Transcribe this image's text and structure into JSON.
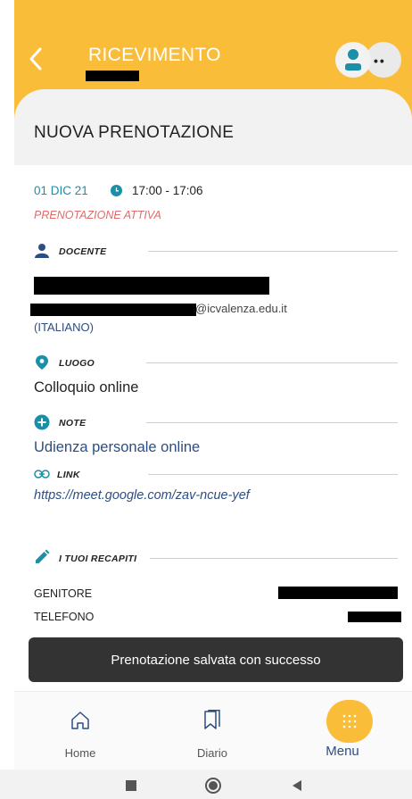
{
  "header": {
    "title": "RICEVIMENTO"
  },
  "page": {
    "title": "NUOVA PRENOTAZIONE"
  },
  "appointment": {
    "date": "01 DIC 21",
    "time": "17:00 - 17:06",
    "status": "PRENOTAZIONE ATTIVA"
  },
  "teacher": {
    "section_label": "DOCENTE",
    "email_suffix": "@icvalenza.edu.it",
    "subject": "(ITALIANO)"
  },
  "place": {
    "section_label": "LUOGO",
    "value": "Colloquio online"
  },
  "notes": {
    "section_label": "NOTE",
    "value": "Udienza personale online"
  },
  "link": {
    "section_label": "LINK",
    "value": "https://meet.google.com/zav-ncue-yef"
  },
  "contacts": {
    "section_label": "I TUOI RECAPITI",
    "rows": [
      {
        "label": "GENITORE"
      },
      {
        "label": "TELEFONO"
      }
    ]
  },
  "toast": {
    "message": "Prenotazione salvata con successo"
  },
  "tabbar": {
    "home_label": "Home",
    "diary_label": "Diario",
    "menu_label": "Menu"
  },
  "colors": {
    "accent": "#f9bd3a",
    "teal": "#1a8fa8",
    "status": "#e06b6b",
    "link": "#2c4e84"
  },
  "icons": [
    "back-icon",
    "user-avatar-icon",
    "more-icon",
    "clock-icon",
    "person-icon",
    "location-icon",
    "plus-circle-icon",
    "link-icon",
    "pencil-icon",
    "home-icon",
    "bookmark-icon",
    "grid-icon",
    "stop-icon",
    "circle-home-icon",
    "triangle-back-icon"
  ]
}
